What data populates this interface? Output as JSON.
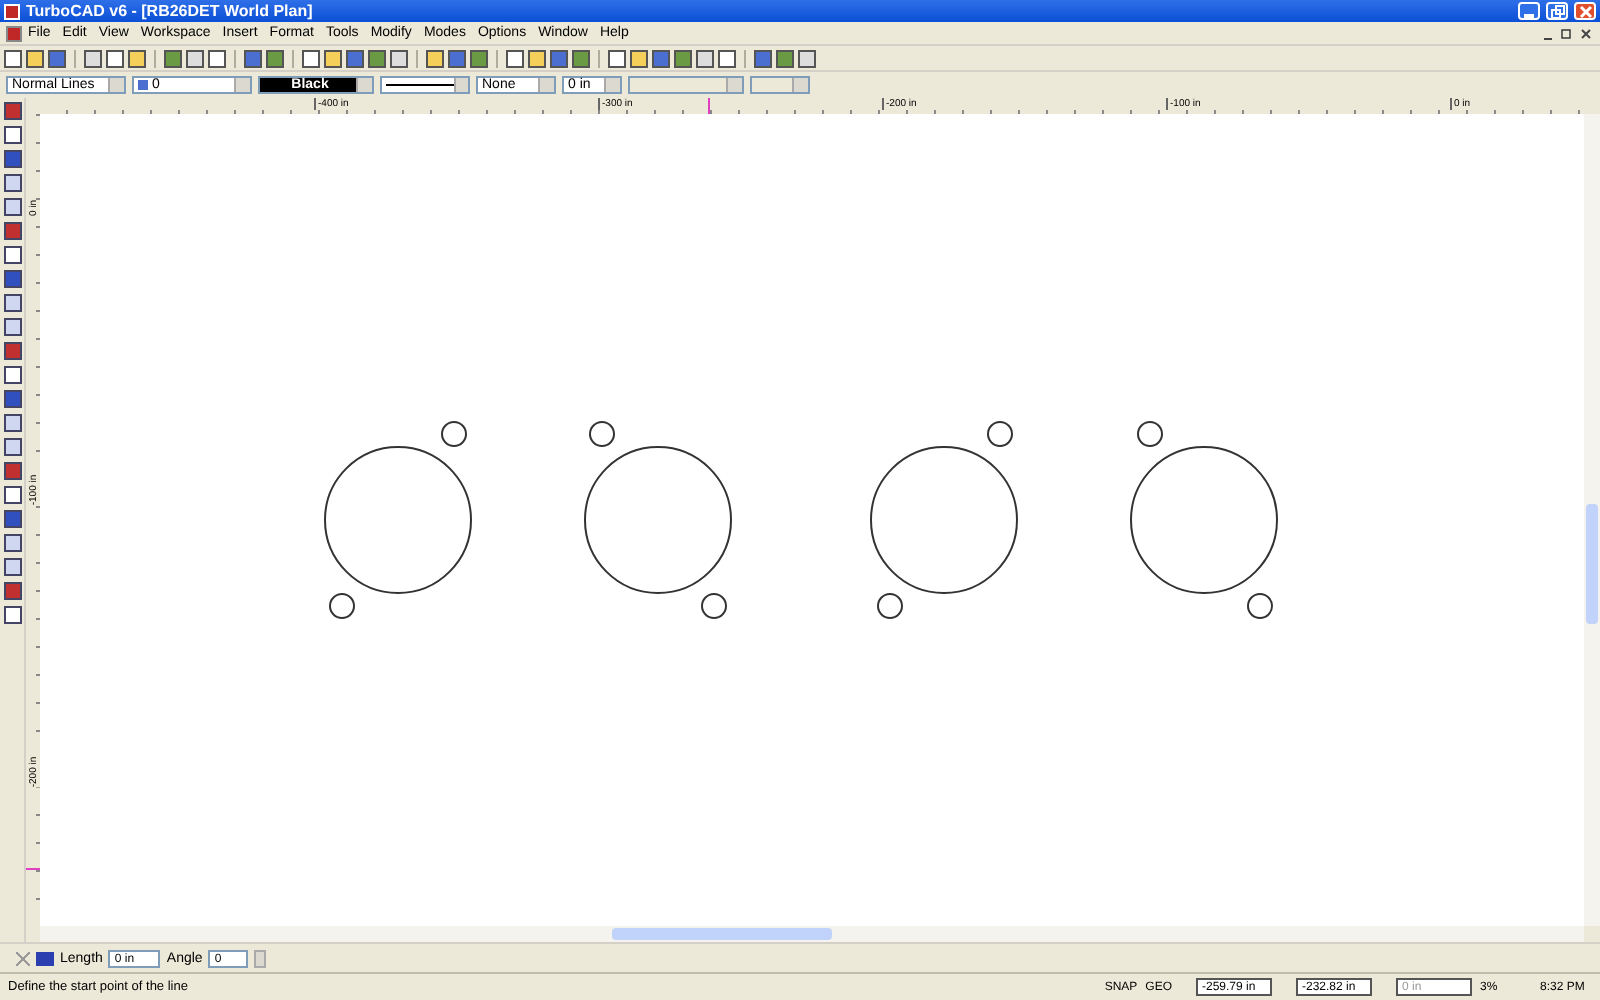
{
  "window": {
    "title": "TurboCAD v6 - [RB26DET World Plan]"
  },
  "menu": [
    "File",
    "Edit",
    "View",
    "Workspace",
    "Insert",
    "Format",
    "Tools",
    "Modify",
    "Modes",
    "Options",
    "Window",
    "Help"
  ],
  "property_bar": {
    "pen_style": "Normal Lines",
    "layer": "0",
    "color_name": "Black",
    "fill": "None",
    "line_width": "0 in"
  },
  "horizontal_ruler": [
    "-400 in",
    "-300 in",
    "-200 in",
    "-100 in",
    "0 in"
  ],
  "vertical_ruler": [
    "0 in",
    "-100 in",
    "-200 in"
  ],
  "inspector": {
    "length_label": "Length",
    "length": "0 in",
    "angle_label": "Angle",
    "angle": "0"
  },
  "status_bar": {
    "prompt": "Define the start point of the line",
    "snap": "SNAP",
    "geo": "GEO",
    "x": "-259.79 in",
    "y": "-232.82 in",
    "z": "0 in",
    "zoom": "3%",
    "time": "8:32 PM"
  }
}
